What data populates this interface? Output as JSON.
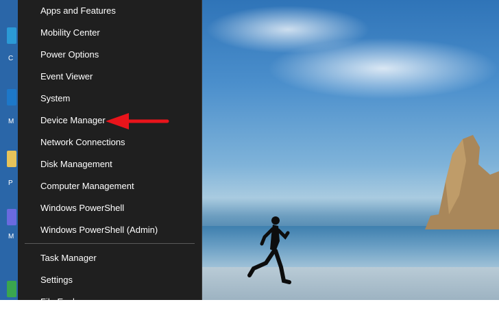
{
  "power_menu": {
    "items": [
      {
        "label": "Apps and Features"
      },
      {
        "label": "Mobility Center"
      },
      {
        "label": "Power Options"
      },
      {
        "label": "Event Viewer"
      },
      {
        "label": "System"
      },
      {
        "label": "Device Manager"
      },
      {
        "label": "Network Connections"
      },
      {
        "label": "Disk Management"
      },
      {
        "label": "Computer Management"
      },
      {
        "label": "Windows PowerShell"
      },
      {
        "label": "Windows PowerShell (Admin)"
      }
    ],
    "items_after_separator": [
      {
        "label": "Task Manager"
      },
      {
        "label": "Settings"
      },
      {
        "label": "File Explorer"
      }
    ]
  },
  "annotation": {
    "arrow_color": "#e8141b",
    "target": "Device Manager"
  },
  "desktop": {
    "wallpaper": "beach-runner-sea-rock",
    "left_icon_fragments": [
      "C",
      "M",
      "P",
      "M"
    ]
  }
}
